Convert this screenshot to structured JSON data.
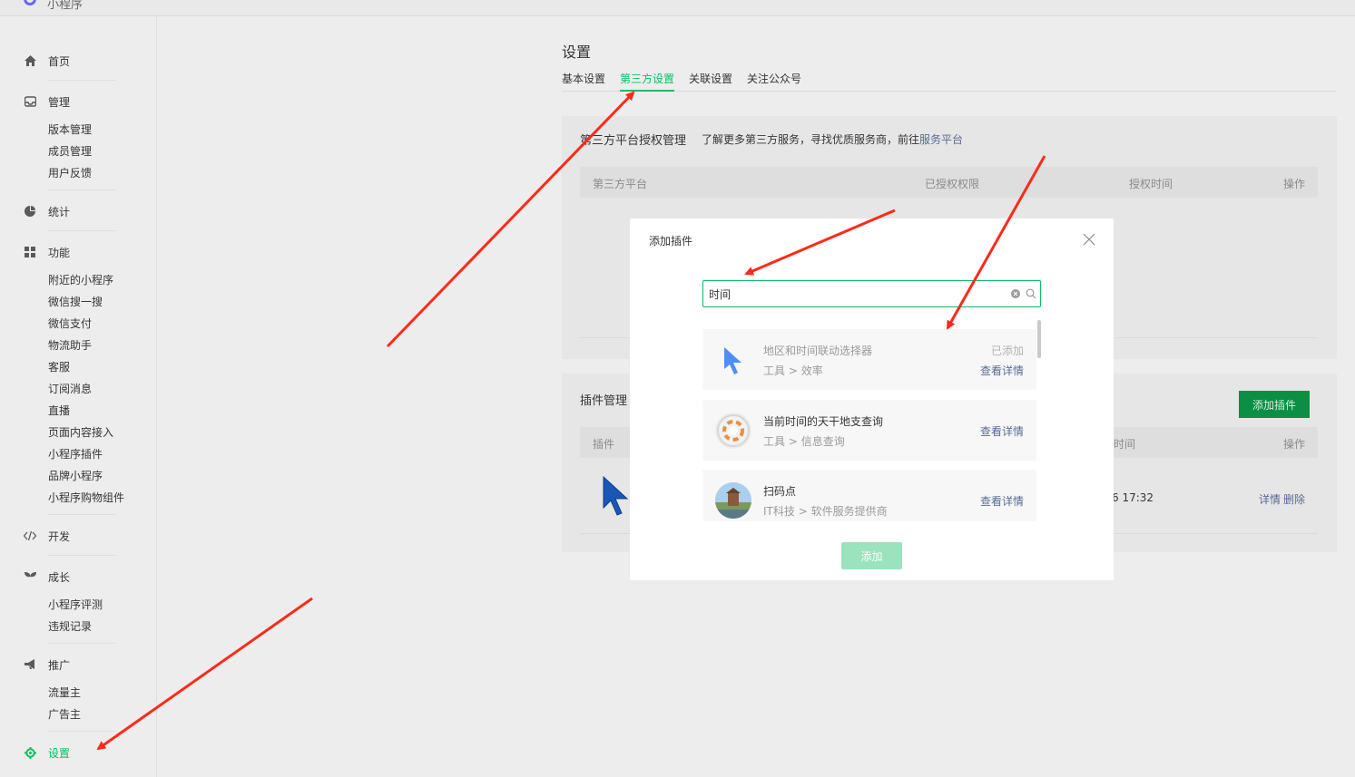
{
  "app": {
    "brand": "小程序"
  },
  "sidebar": {
    "home": "首页",
    "manage": {
      "label": "管理",
      "items": [
        "版本管理",
        "成员管理",
        "用户反馈"
      ]
    },
    "stats": "统计",
    "features": {
      "label": "功能",
      "items": [
        "附近的小程序",
        "微信搜一搜",
        "微信支付",
        "物流助手",
        "客服",
        "订阅消息",
        "直播",
        "页面内容接入",
        "小程序插件",
        "品牌小程序",
        "小程序购物组件"
      ]
    },
    "dev": "开发",
    "growth": {
      "label": "成长",
      "items": [
        "小程序评测",
        "违规记录"
      ]
    },
    "promo": {
      "label": "推广",
      "items": [
        "流量主",
        "广告主"
      ]
    },
    "settings": "设置"
  },
  "main": {
    "title": "设置",
    "tabs": [
      "基本设置",
      "第三方设置",
      "关联设置",
      "关注公众号"
    ],
    "active_tab": "第三方设置",
    "auth_card": {
      "title": "第三方平台授权管理",
      "desc": "了解更多第三方服务，寻找优质服务商，前往",
      "link": "服务平台",
      "columns": [
        "第三方平台",
        "已授权权限",
        "授权时间",
        "操作"
      ]
    },
    "plugin_card": {
      "title": "插件管理",
      "add_button": "添加插件",
      "columns": [
        "插件",
        "时间",
        "操作"
      ],
      "row_time": "6 17:32",
      "row_actions": [
        "详情",
        "删除"
      ]
    }
  },
  "modal": {
    "title": "添加插件",
    "search_value": "时间",
    "results": [
      {
        "name": "地区和时间联动选择器",
        "category": "工具",
        "subcategory": "效率",
        "status": "已添加",
        "detail": "查看详情",
        "icon": "cursor-icon"
      },
      {
        "name": "当前时间的天干地支查询",
        "category": "工具",
        "subcategory": "信息查询",
        "status": "",
        "detail": "查看详情",
        "icon": "lifebuoy-icon"
      },
      {
        "name": "扫码点",
        "category": "IT科技",
        "subcategory": "软件服务提供商",
        "status": "",
        "detail": "查看详情",
        "icon": "landscape-avatar"
      }
    ],
    "separator": ">",
    "add_button": "添加"
  },
  "colors": {
    "accent": "#07c160",
    "link": "#576b95",
    "annotation": "#ff2a1a"
  }
}
